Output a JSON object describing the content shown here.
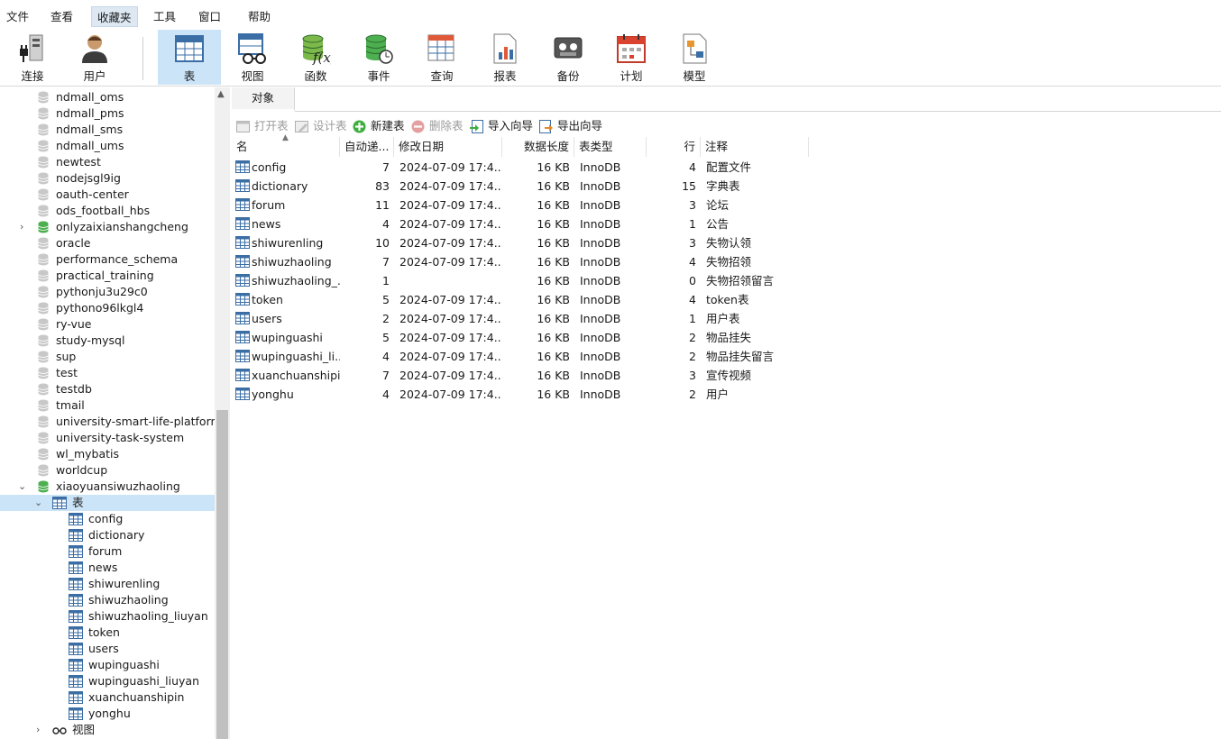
{
  "menu": [
    "文件",
    "查看",
    "收藏夹",
    "工具",
    "窗口",
    "帮助"
  ],
  "menu_active": "收藏夹",
  "toolbar": [
    {
      "label": "连接",
      "icon": "connection-plug-icon"
    },
    {
      "label": "用户",
      "icon": "user-icon"
    },
    {
      "label": "表",
      "icon": "table-icon",
      "active": true
    },
    {
      "label": "视图",
      "icon": "view-glasses-icon"
    },
    {
      "label": "函数",
      "icon": "function-icon"
    },
    {
      "label": "事件",
      "icon": "event-clock-icon"
    },
    {
      "label": "查询",
      "icon": "query-icon"
    },
    {
      "label": "报表",
      "icon": "report-icon"
    },
    {
      "label": "备份",
      "icon": "backup-tape-icon"
    },
    {
      "label": "计划",
      "icon": "calendar-icon"
    },
    {
      "label": "模型",
      "icon": "model-icon"
    }
  ],
  "sidebar": {
    "databases": [
      {
        "name": "ndmall_oms"
      },
      {
        "name": "ndmall_pms"
      },
      {
        "name": "ndmall_sms"
      },
      {
        "name": "ndmall_ums"
      },
      {
        "name": "newtest"
      },
      {
        "name": "nodejsgl9ig"
      },
      {
        "name": "oauth-center"
      },
      {
        "name": "ods_football_hbs"
      },
      {
        "name": "onlyzaixianshangcheng",
        "open": true,
        "collapsed": true
      },
      {
        "name": "oracle"
      },
      {
        "name": "performance_schema"
      },
      {
        "name": "practical_training"
      },
      {
        "name": "pythonju3u29c0"
      },
      {
        "name": "pythono96lkgl4"
      },
      {
        "name": "ry-vue"
      },
      {
        "name": "study-mysql"
      },
      {
        "name": "sup"
      },
      {
        "name": "test"
      },
      {
        "name": "testdb"
      },
      {
        "name": "tmail"
      },
      {
        "name": "university-smart-life-platform"
      },
      {
        "name": "university-task-system"
      },
      {
        "name": "wl_mybatis"
      },
      {
        "name": "worldcup"
      },
      {
        "name": "xiaoyuansiwuzhaoling",
        "open": true,
        "expanded": true
      }
    ],
    "tables_folder": "表",
    "tables": [
      "config",
      "dictionary",
      "forum",
      "news",
      "shiwurenling",
      "shiwuzhaoling",
      "shiwuzhaoling_liuyan",
      "token",
      "users",
      "wupinguashi",
      "wupinguashi_liuyan",
      "xuanchuanshipin",
      "yonghu"
    ],
    "views_folder": "视图"
  },
  "main": {
    "tab_label": "对象",
    "actions": [
      {
        "label": "打开表",
        "icon": "open-table-icon",
        "enabled": false
      },
      {
        "label": "设计表",
        "icon": "design-table-icon",
        "enabled": false
      },
      {
        "label": "新建表",
        "icon": "new-table-icon",
        "enabled": true
      },
      {
        "label": "删除表",
        "icon": "delete-table-icon",
        "enabled": false
      },
      {
        "label": "导入向导",
        "icon": "import-wizard-icon",
        "enabled": true
      },
      {
        "label": "导出向导",
        "icon": "export-wizard-icon",
        "enabled": true
      }
    ],
    "columns": [
      "名",
      "自动递...",
      "修改日期",
      "数据长度",
      "表类型",
      "行",
      "注释"
    ],
    "rows": [
      [
        "config",
        "7",
        "2024-07-09 17:4...",
        "16 KB",
        "InnoDB",
        "4",
        "配置文件"
      ],
      [
        "dictionary",
        "83",
        "2024-07-09 17:4...",
        "16 KB",
        "InnoDB",
        "15",
        "字典表"
      ],
      [
        "forum",
        "11",
        "2024-07-09 17:4...",
        "16 KB",
        "InnoDB",
        "3",
        "论坛"
      ],
      [
        "news",
        "4",
        "2024-07-09 17:4...",
        "16 KB",
        "InnoDB",
        "1",
        "公告"
      ],
      [
        "shiwurenling",
        "10",
        "2024-07-09 17:4...",
        "16 KB",
        "InnoDB",
        "3",
        "失物认领"
      ],
      [
        "shiwuzhaoling",
        "7",
        "2024-07-09 17:4...",
        "16 KB",
        "InnoDB",
        "4",
        "失物招领"
      ],
      [
        "shiwuzhaoling_...",
        "1",
        "",
        "16 KB",
        "InnoDB",
        "0",
        "失物招领留言"
      ],
      [
        "token",
        "5",
        "2024-07-09 17:4...",
        "16 KB",
        "InnoDB",
        "4",
        "token表"
      ],
      [
        "users",
        "2",
        "2024-07-09 17:4...",
        "16 KB",
        "InnoDB",
        "1",
        "用户表"
      ],
      [
        "wupinguashi",
        "5",
        "2024-07-09 17:4...",
        "16 KB",
        "InnoDB",
        "2",
        "物品挂失"
      ],
      [
        "wupinguashi_li...",
        "4",
        "2024-07-09 17:4...",
        "16 KB",
        "InnoDB",
        "2",
        "物品挂失留言"
      ],
      [
        "xuanchuanshipin",
        "7",
        "2024-07-09 17:4...",
        "16 KB",
        "InnoDB",
        "3",
        "宣传视频"
      ],
      [
        "yonghu",
        "4",
        "2024-07-09 17:4...",
        "16 KB",
        "InnoDB",
        "2",
        "用户"
      ]
    ]
  },
  "colors": {
    "selection": "#cce4f7",
    "db_open": "#4caf50",
    "db_closed": "#c8c8c8"
  }
}
